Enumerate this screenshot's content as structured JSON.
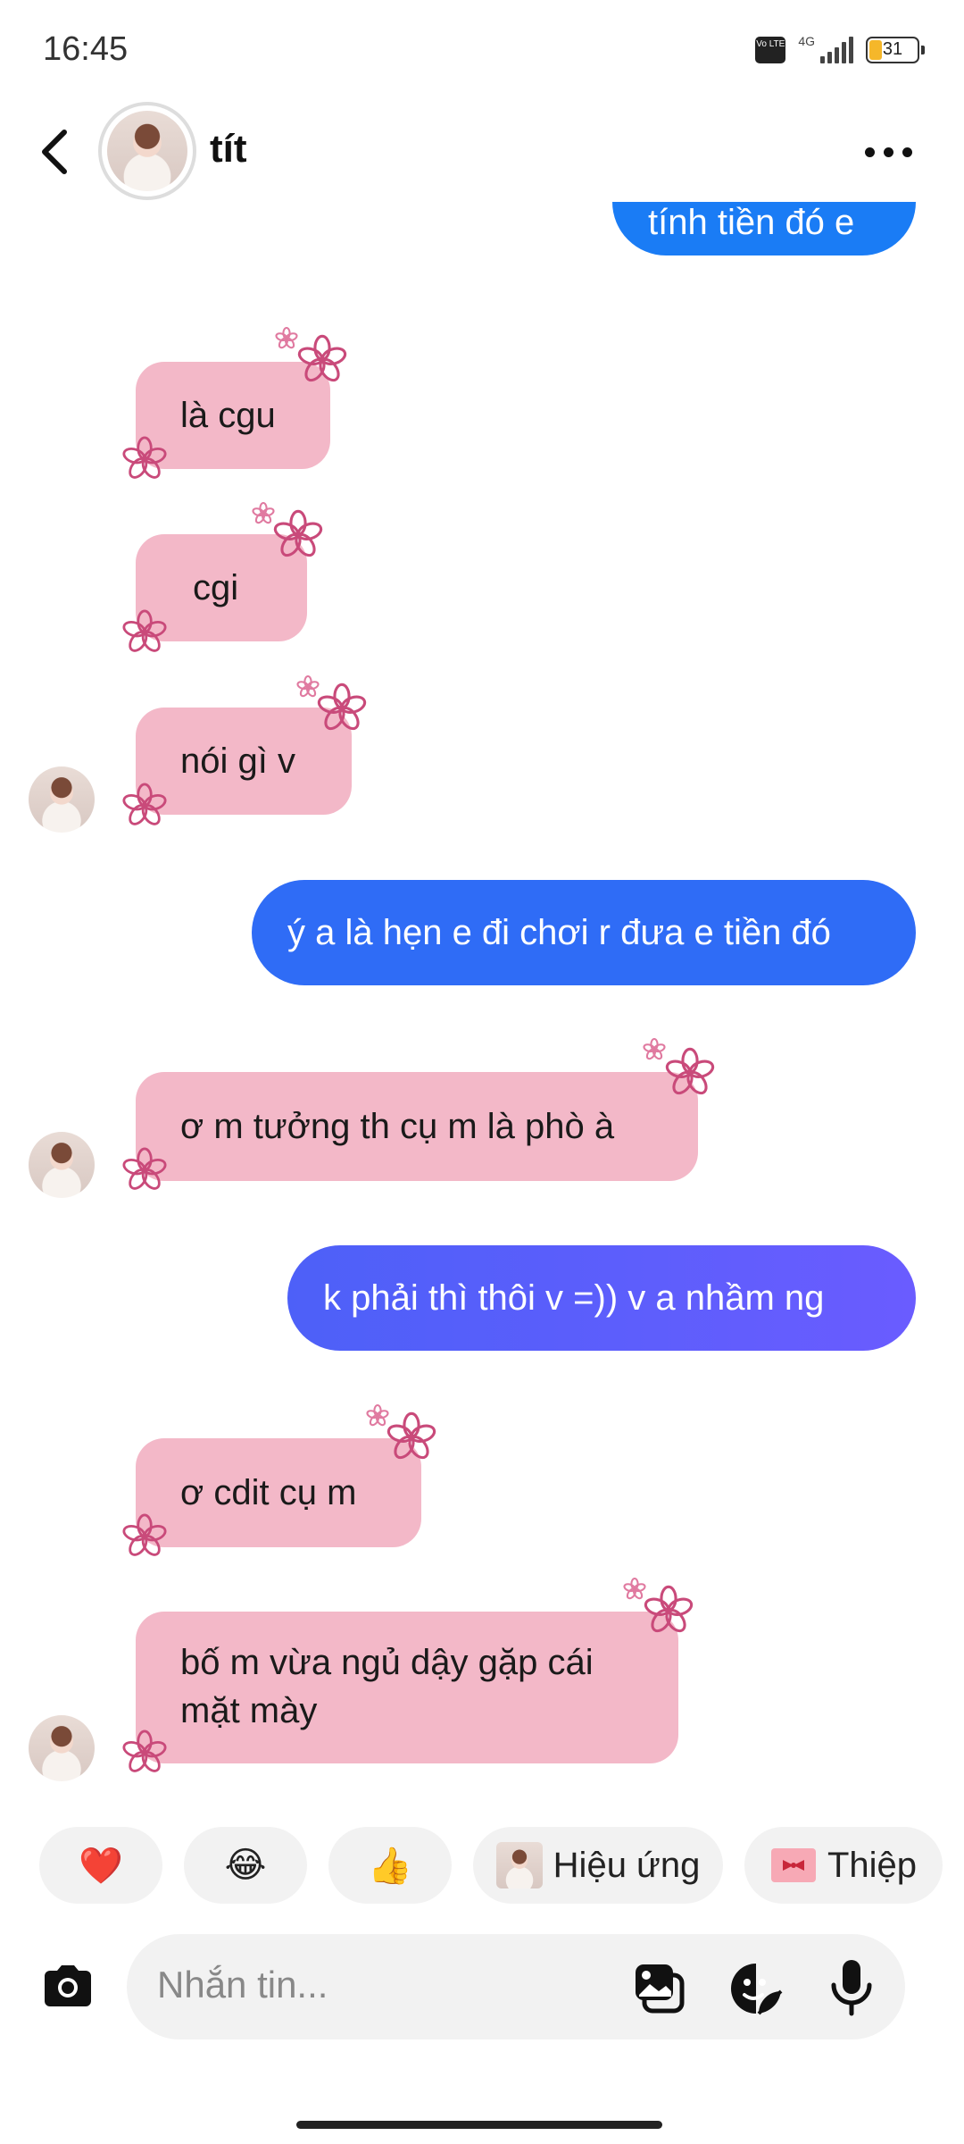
{
  "status_bar": {
    "time": "16:45",
    "network": "4G",
    "volte": "Vo LTE",
    "battery": "31"
  },
  "header": {
    "contact_name": "tít"
  },
  "messages": [
    {
      "dir": "out",
      "text": "tính tiền đó e"
    },
    {
      "dir": "in",
      "text": "là cgu"
    },
    {
      "dir": "in",
      "text": "cgi"
    },
    {
      "dir": "in",
      "text": "nói gì v"
    },
    {
      "dir": "out",
      "text": "ý a là hẹn e đi chơi r đưa e tiền đó"
    },
    {
      "dir": "in",
      "text": "ơ m tưởng th cụ m là phò à"
    },
    {
      "dir": "out",
      "text": "k phải thì thôi v =)) v a nhầm ng"
    },
    {
      "dir": "in",
      "text": "ơ cdit cụ m"
    },
    {
      "dir": "in",
      "text": "bố m vừa ngủ dậy gặp cái mặt mày"
    }
  ],
  "quick_reactions": {
    "heart": "❤️",
    "laugh": "😂",
    "like": "👍",
    "effects_label": "Hiệu ứng",
    "card_label": "Thiệp"
  },
  "composer": {
    "placeholder": "Nhắn tin..."
  },
  "colors": {
    "incoming_bubble": "#f3b8c8",
    "outgoing_top": "#1a7cf5",
    "outgoing_bottom": "#6a5cff",
    "flower": "#c94a7a"
  }
}
